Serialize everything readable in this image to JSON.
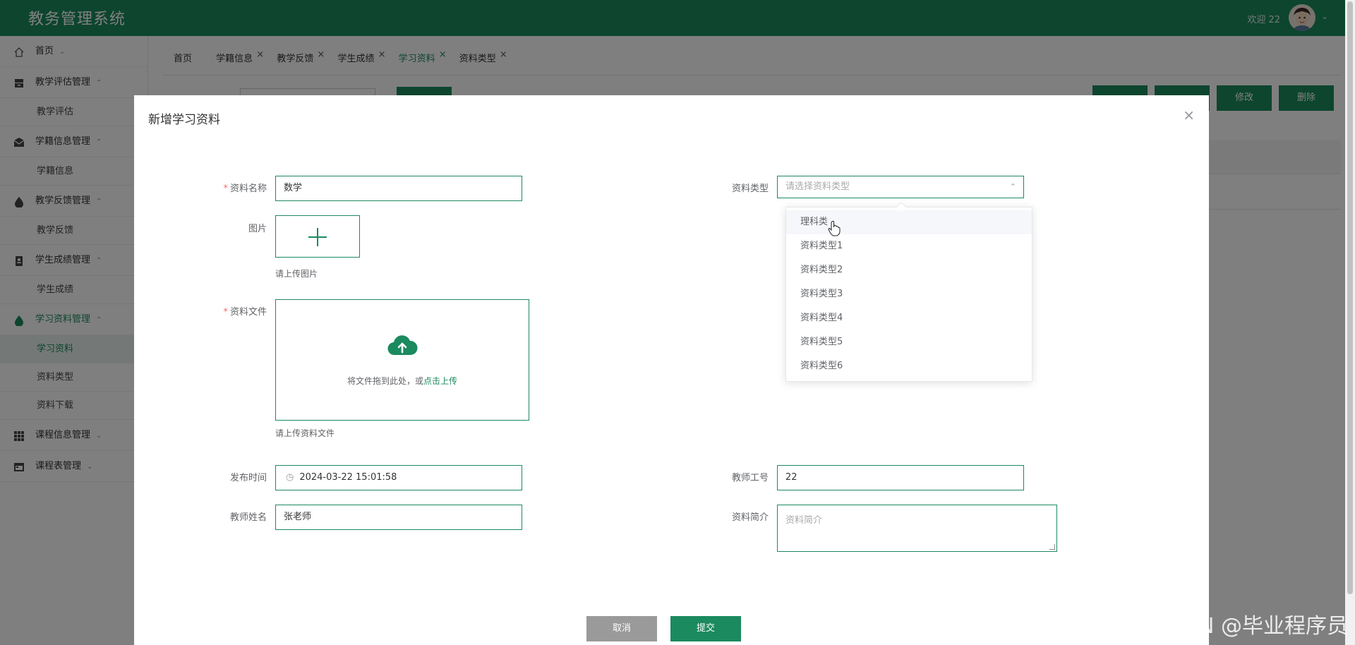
{
  "header": {
    "app_title": "教务管理系统",
    "welcome": "欢迎 22",
    "chevron": "⌄",
    "brand_color": "#1b8a5e"
  },
  "sidebar": {
    "items": [
      {
        "label": "首页",
        "icon": "home-icon",
        "caret": "⌄"
      },
      {
        "label": "教学评估管理",
        "icon": "archive-icon",
        "caret": "⌃",
        "children": [
          "教学评估"
        ]
      },
      {
        "label": "学籍信息管理",
        "icon": "mail-icon",
        "caret": "⌃",
        "children": [
          "学籍信息"
        ]
      },
      {
        "label": "教学反馈管理",
        "icon": "drop-icon",
        "caret": "⌃",
        "children": [
          "教学反馈"
        ]
      },
      {
        "label": "学生成绩管理",
        "icon": "book-icon",
        "caret": "⌃",
        "children": [
          "学生成绩"
        ]
      },
      {
        "label": "学习资料管理",
        "icon": "drop-icon",
        "caret": "⌃",
        "children": [
          "学习资料",
          "资料类型",
          "资料下载"
        ]
      },
      {
        "label": "课程信息管理",
        "icon": "grid-icon",
        "caret": "⌄"
      },
      {
        "label": "课程表管理",
        "icon": "calendar-icon",
        "caret": "⌄"
      }
    ]
  },
  "tabs": [
    {
      "label": "首页",
      "close": ""
    },
    {
      "label": "学籍信息",
      "close": "×"
    },
    {
      "label": "教学反馈",
      "close": "×"
    },
    {
      "label": "学生成绩",
      "close": "×"
    },
    {
      "label": "学习资料",
      "close": "×"
    },
    {
      "label": "资料类型",
      "close": "×"
    }
  ],
  "toolbar": {
    "edit_label": "修改",
    "delete_label": "删除"
  },
  "dialog": {
    "title": "新增学习资料",
    "close": "×",
    "name_label": "资料名称",
    "name_value": "数学",
    "required_mark": "*",
    "image_label": "图片",
    "image_hint": "请上传图片",
    "file_label": "资料文件",
    "file_drag_text": "将文件拖到此处，或",
    "file_drag_link": "点击上传",
    "file_hint": "请上传资料文件",
    "type_label": "资料类型",
    "type_placeholder": "请选择资料类型",
    "type_arrow": "⌃",
    "type_options": [
      "理科类",
      "资料类型1",
      "资料类型2",
      "资料类型3",
      "资料类型4",
      "资料类型5",
      "资料类型6"
    ],
    "publish_label": "发布时间",
    "publish_value": "2024-03-22 15:01:58",
    "clock_glyph": "◷",
    "teacher_id_label": "教师工号",
    "teacher_id_value": "22",
    "teacher_name_label": "教师姓名",
    "teacher_name_value": "张老师",
    "intro_label": "资料简介",
    "intro_placeholder": "资料简介",
    "cancel_label": "取消",
    "submit_label": "提交"
  },
  "watermark": "CSDN @毕业程序员"
}
